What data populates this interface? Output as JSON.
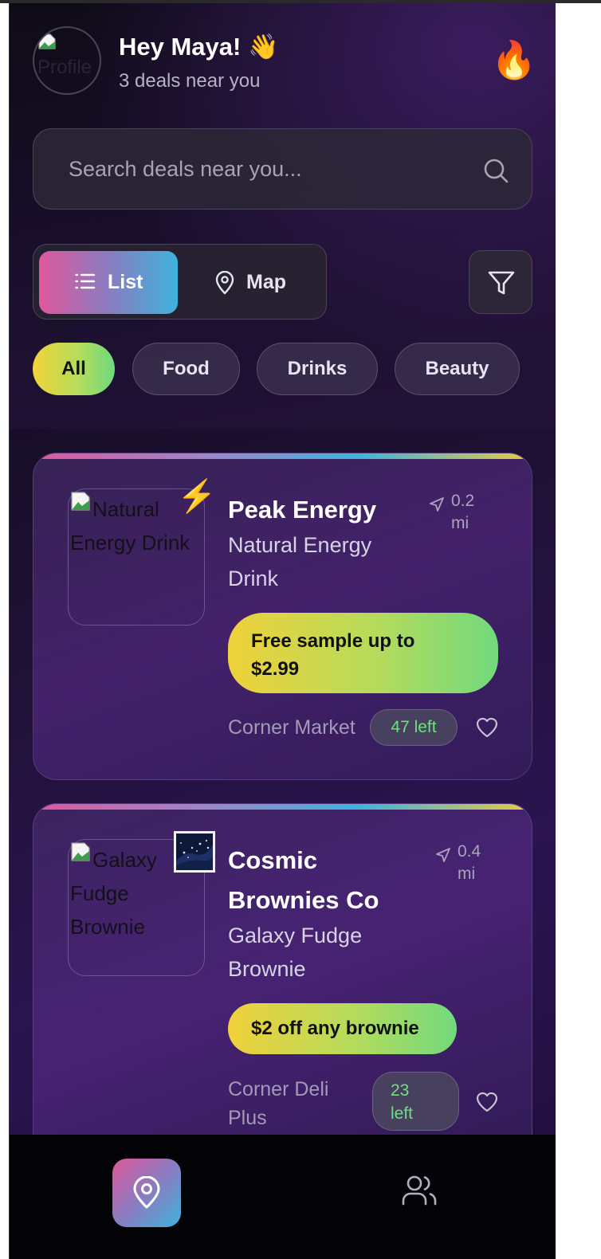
{
  "header": {
    "avatar_alt": "Profile",
    "greeting": "Hey Maya! 👋",
    "subtitle": "3 deals near you",
    "streak_emoji": "🔥"
  },
  "search": {
    "placeholder": "Search deals near you...",
    "icon": "search-icon"
  },
  "view_toggle": {
    "list_label": "List",
    "map_label": "Map",
    "active": "List"
  },
  "filter_icon": "filter-icon",
  "categories": [
    {
      "label": "All",
      "active": true
    },
    {
      "label": "Food",
      "active": false
    },
    {
      "label": "Drinks",
      "active": false
    },
    {
      "label": "Beauty",
      "active": false
    }
  ],
  "deals": [
    {
      "image_alt": "Natural Energy Drink",
      "emoji": "⚡",
      "brand": "Peak Energy",
      "distance_value": "0.2",
      "distance_unit": "mi",
      "product_line1": "Natural Energy",
      "product_line2": "Drink",
      "offer_line1": "Free sample up to",
      "offer_line2": "$2.99",
      "store": "Corner Market",
      "remaining": "47 left"
    },
    {
      "image_alt": "Galaxy Fudge Brownie",
      "emoji": "🌌",
      "brand_line1": "Cosmic",
      "brand_line2": "Brownies Co",
      "distance_value": "0.4",
      "distance_unit": "mi",
      "product_line1": "Galaxy Fudge",
      "product_line2": "Brownie",
      "offer": "$2 off any brownie",
      "store_line1": "Corner Deli",
      "store_line2": "Plus",
      "remaining_line1": "23",
      "remaining_line2": "left"
    }
  ],
  "bottom_nav": [
    {
      "icon": "map-pin-icon",
      "active": true
    },
    {
      "icon": "users-icon",
      "active": false
    }
  ],
  "colors": {
    "accent_gradient_start": "#e0589c",
    "accent_gradient_end": "#3eb3dc",
    "deal_gradient_start": "#f0d13a",
    "deal_gradient_end": "#72d97d",
    "remaining_text": "#6ee07e"
  }
}
